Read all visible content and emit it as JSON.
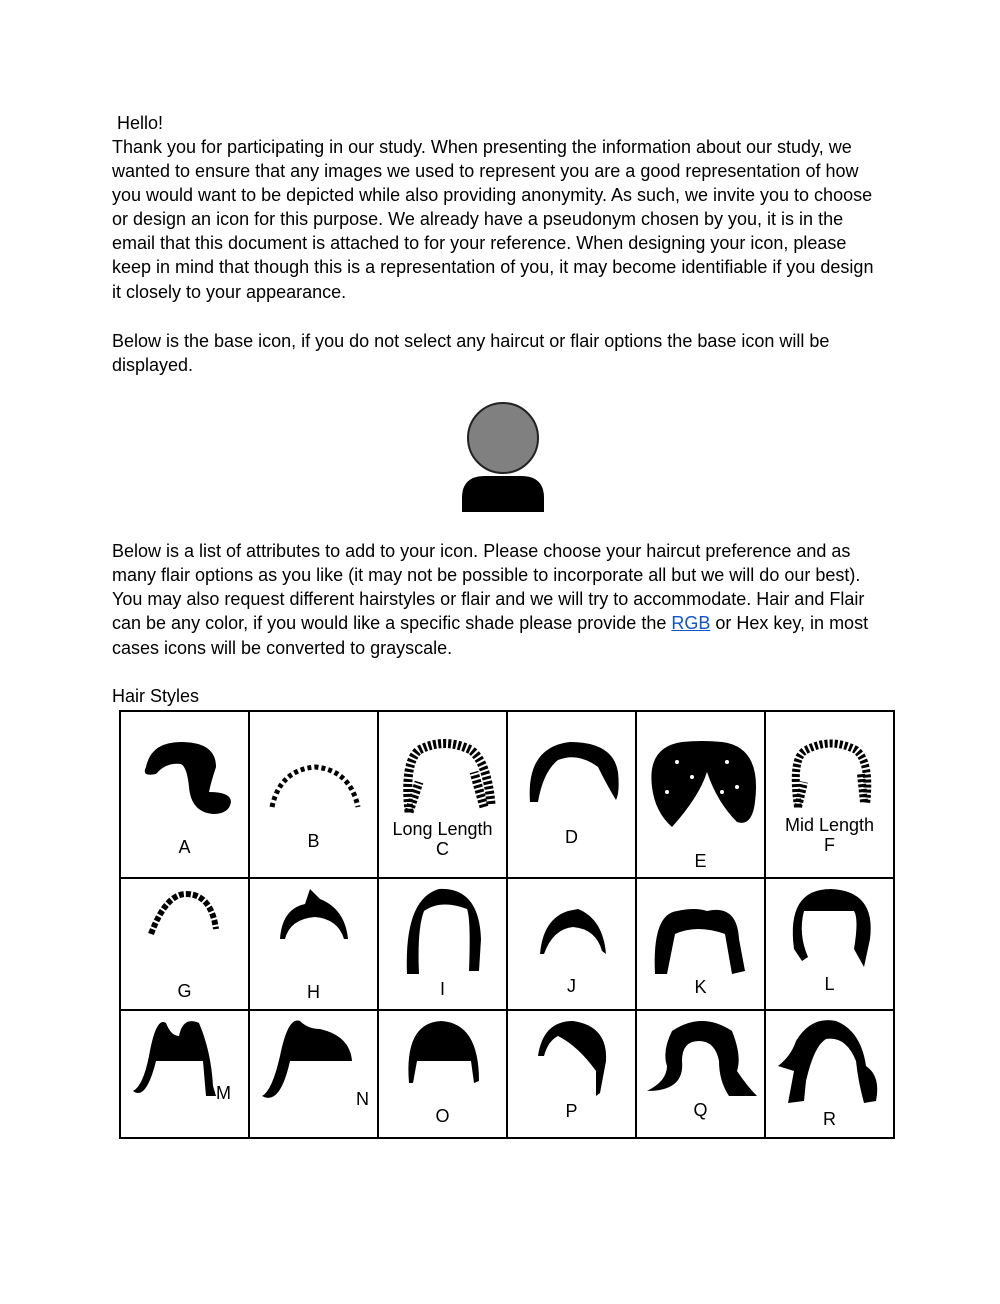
{
  "greeting": " Hello!",
  "intro_lines": [
    "Thank you for participating in our study. When presenting the information about our study, we",
    "wanted to ensure that any images we used to represent you are a good representation of how",
    "you would want to be depicted while also providing anonymity. As such, we invite you to choose",
    "or design an icon for this purpose. We already have a pseudonym chosen by you, it is in the",
    "email that this document is attached to for your reference. When designing your icon, please",
    "keep in mind that though this is a representation of you, it may become identifiable if you design",
    "it closely to your appearance."
  ],
  "base_icon_lines": [
    "Below is the base icon, if you do not select any haircut or flair options the base icon will be",
    "displayed."
  ],
  "base_icon": {
    "head_color": "#808080",
    "body_color": "#000000"
  },
  "attributes_lines": [
    "Below is a list of attributes to add to your icon. Please choose your haircut preference and as",
    "many flair options as you like (it may not be possible to incorporate all but we will do our best).",
    "You may also request different hairstyles or flair and we will try to accommodate. Hair and Flair"
  ],
  "color_line": {
    "before": "can be any color, if you would like a specific shade please provide the ",
    "link": "RGB",
    "after": " or Hex key, in most",
    "link_color": "#1155cc"
  },
  "last_line": "cases icons will be converted to grayscale.",
  "hair_styles_heading": "Hair Styles",
  "hair_styles": [
    {
      "label": "A"
    },
    {
      "label": "B"
    },
    {
      "label": "C",
      "caption": "Long Length"
    },
    {
      "label": "D"
    },
    {
      "label": "E"
    },
    {
      "label": "F",
      "caption": "Mid Length"
    },
    {
      "label": "G"
    },
    {
      "label": "H"
    },
    {
      "label": "I"
    },
    {
      "label": "J"
    },
    {
      "label": "K"
    },
    {
      "label": "L"
    },
    {
      "label": "M"
    },
    {
      "label": "N"
    },
    {
      "label": "O"
    },
    {
      "label": "P"
    },
    {
      "label": "Q"
    },
    {
      "label": "R"
    }
  ]
}
